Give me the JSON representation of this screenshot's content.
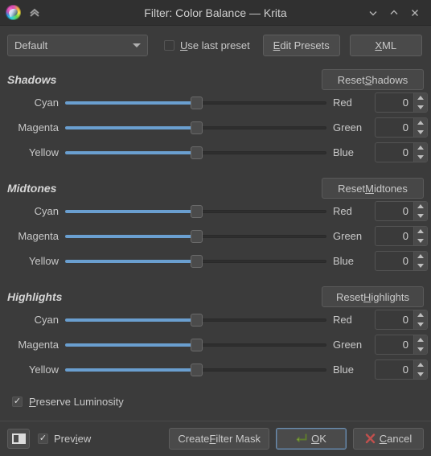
{
  "window": {
    "title": "Filter: Color Balance — Krita",
    "logo_icon": "krita-logo-icon",
    "collapse_icon": "double-chevron-up-icon",
    "controls": [
      {
        "name": "minimize",
        "icon": "chevron-down-icon"
      },
      {
        "name": "maximize",
        "icon": "chevron-up-icon"
      },
      {
        "name": "close",
        "icon": "close-x-icon"
      }
    ]
  },
  "preset_row": {
    "combo_value": "Default",
    "combo_icon": "chevron-down-icon",
    "use_last_preset": {
      "label_prefix": "U",
      "label_rest": "se last preset",
      "checked": false,
      "check_glyph": ""
    },
    "edit_presets": {
      "prefix": "E",
      "rest": "dit Presets"
    },
    "xml": {
      "prefix": "X",
      "rest": "ML"
    }
  },
  "groups": [
    {
      "title": "Shadows",
      "reset": {
        "pre": "Reset ",
        "accel": "S",
        "post": "hadows"
      },
      "rows": [
        {
          "left": "Cyan",
          "right": "Red",
          "value": "0",
          "position": 50
        },
        {
          "left": "Magenta",
          "right": "Green",
          "value": "0",
          "position": 50
        },
        {
          "left": "Yellow",
          "right": "Blue",
          "value": "0",
          "position": 50
        }
      ]
    },
    {
      "title": "Midtones",
      "reset": {
        "pre": "Reset ",
        "accel": "M",
        "post": "idtones"
      },
      "rows": [
        {
          "left": "Cyan",
          "right": "Red",
          "value": "0",
          "position": 50
        },
        {
          "left": "Magenta",
          "right": "Green",
          "value": "0",
          "position": 50
        },
        {
          "left": "Yellow",
          "right": "Blue",
          "value": "0",
          "position": 50
        }
      ]
    },
    {
      "title": "Highlights",
      "reset": {
        "pre": "Reset ",
        "accel": "H",
        "post": "ighlights"
      },
      "rows": [
        {
          "left": "Cyan",
          "right": "Red",
          "value": "0",
          "position": 50
        },
        {
          "left": "Magenta",
          "right": "Green",
          "value": "0",
          "position": 50
        },
        {
          "left": "Yellow",
          "right": "Blue",
          "value": "0",
          "position": 50
        }
      ]
    }
  ],
  "preserve_luminosity": {
    "prefix": "P",
    "rest": "reserve Luminosity",
    "checked": true,
    "check_glyph": "✓"
  },
  "bottom": {
    "preview_toggle_icon": "preview-panel-icon",
    "preview": {
      "prefix": "Prev",
      "accel": "i",
      "post": "ew",
      "checked": true,
      "check_glyph": "✓"
    },
    "create_filter_mask": {
      "pre": "Create ",
      "accel": "F",
      "post": "ilter Mask"
    },
    "ok": {
      "accel": "O",
      "post": "K",
      "icon": "enter-arrow-icon"
    },
    "cancel": {
      "accel": "C",
      "post": "ancel",
      "icon": "red-x-icon"
    }
  },
  "colors": {
    "window_bg": "#3b3b3b",
    "titlebar_bg": "#303030",
    "slider_fill": "#6a9fd0",
    "ok_focus_border": "#6e8faf",
    "cancel_x": "#c0504d",
    "ok_arrow": "#8aa84a"
  }
}
